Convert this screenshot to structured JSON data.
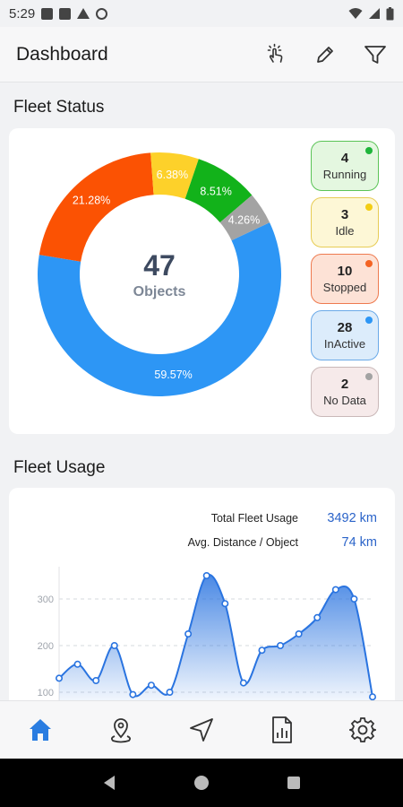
{
  "status_bar": {
    "time": "5:29"
  },
  "app_bar": {
    "title": "Dashboard"
  },
  "fleet_status": {
    "title": "Fleet Status",
    "total": "47",
    "total_label": "Objects",
    "chart_data": {
      "type": "pie",
      "categories": [
        "InActive",
        "Stopped",
        "Idle",
        "Running",
        "No Data"
      ],
      "values": [
        59.57,
        21.28,
        6.38,
        8.51,
        4.26
      ],
      "labels": [
        "59.57%",
        "21.28%",
        "6.38%",
        "8.51%",
        "4.26%"
      ],
      "colors": [
        "#2d96f5",
        "#fb5203",
        "#fdd12a",
        "#12b21a",
        "#a3a3a3"
      ]
    },
    "chips": [
      {
        "count": "4",
        "label": "Running",
        "bg": "#e4f7e0",
        "border": "#5bc457",
        "dot": "#1fb53b"
      },
      {
        "count": "3",
        "label": "Idle",
        "bg": "#fdf7d6",
        "border": "#e7cc55",
        "dot": "#f3cd14"
      },
      {
        "count": "10",
        "label": "Stopped",
        "bg": "#fde2d6",
        "border": "#ee7a4f",
        "dot": "#f46323"
      },
      {
        "count": "28",
        "label": "InActive",
        "bg": "#dcecfb",
        "border": "#6aa9e8",
        "dot": "#2d96f5"
      },
      {
        "count": "2",
        "label": "No Data",
        "bg": "#f6eaea",
        "border": "#c9b8b8",
        "dot": "#a3a3a3"
      }
    ]
  },
  "fleet_usage": {
    "title": "Fleet Usage",
    "total_label": "Total Fleet Usage",
    "total_value": "3492 km",
    "avg_label": "Avg. Distance / Object",
    "avg_value": "74 km",
    "chart_data": {
      "type": "area",
      "y_ticks": [
        "300",
        "200",
        "100"
      ],
      "y_tick_values": [
        300,
        200,
        100
      ],
      "ylim": [
        80,
        350
      ],
      "values": [
        130,
        160,
        125,
        200,
        95,
        115,
        100,
        225,
        350,
        290,
        120,
        190,
        200,
        225,
        260,
        320,
        300,
        90
      ],
      "color": "#2a74e0"
    }
  },
  "bottom_nav": {
    "items": [
      {
        "name": "home",
        "color": "#2a7de1"
      },
      {
        "name": "map-pin",
        "color": "#333"
      },
      {
        "name": "navigate",
        "color": "#333"
      },
      {
        "name": "reports",
        "color": "#333"
      },
      {
        "name": "settings",
        "color": "#333"
      }
    ]
  }
}
